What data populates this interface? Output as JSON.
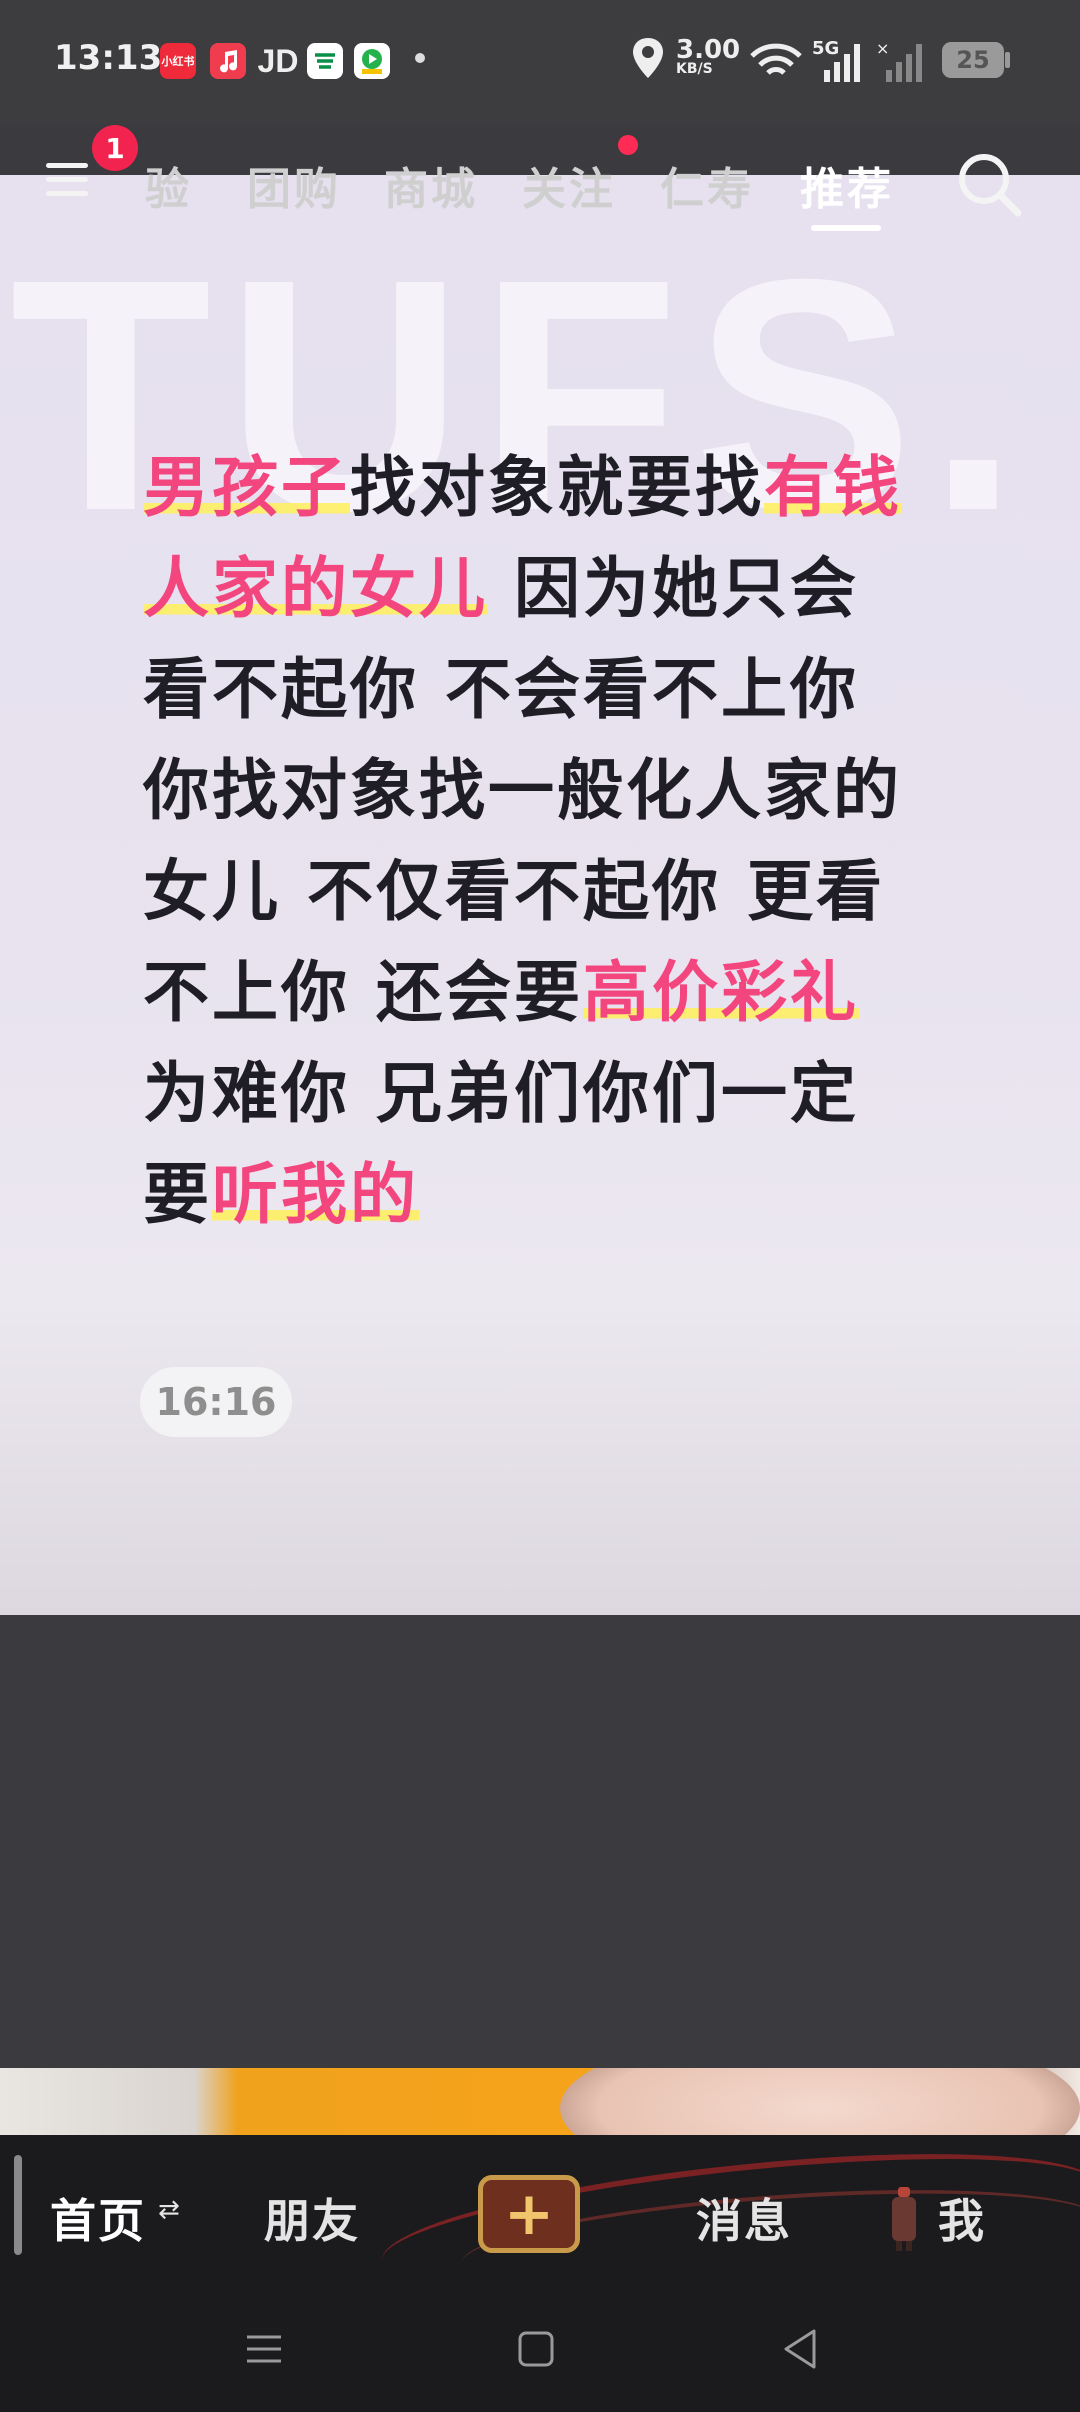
{
  "status_bar": {
    "time": "13:13",
    "apps": [
      "小红书",
      "music",
      "JD",
      "post",
      "video"
    ],
    "jd_label": "JD",
    "xhs_label": "小红书",
    "speed_value": "3.00",
    "speed_unit": "KB/S",
    "network": "5G",
    "battery": "25"
  },
  "top_nav": {
    "menu_badge": "1",
    "tabs": [
      "验",
      "团购",
      "商城",
      "关注",
      "仁寿",
      "推荐"
    ],
    "active_tab": "推荐"
  },
  "post": {
    "watermark": "TUFS.",
    "lines": [
      [
        {
          "t": "男孩子",
          "h": true
        },
        {
          "t": "找对象就要找",
          "h": false
        },
        {
          "t": "有钱",
          "h": true
        }
      ],
      [
        {
          "t": "人家的女儿",
          "h": true
        },
        {
          "t": " 因为她只会",
          "h": false
        }
      ],
      [
        {
          "t": "看不起你 不会看不上你",
          "h": false
        }
      ],
      [
        {
          "t": "你找对象找一般化人家的",
          "h": false
        }
      ],
      [
        {
          "t": "女儿 不仅看不起你 更看",
          "h": false
        }
      ],
      [
        {
          "t": "不上你 还会要",
          "h": false
        },
        {
          "t": "高价彩礼",
          "h": true
        }
      ],
      [
        {
          "t": "为难你 兄弟们你们一定",
          "h": false
        }
      ],
      [
        {
          "t": "要",
          "h": false
        },
        {
          "t": "听我的",
          "h": true
        }
      ]
    ],
    "time_tag": "16:16"
  },
  "bottom_tabs": {
    "home": "首页",
    "home_swap": "⇄",
    "friends": "朋友",
    "plus": "+",
    "messages": "消息",
    "me": "我"
  },
  "colors": {
    "highlight_pink": "#f3467f",
    "highlight_yellow": "#fff05a",
    "badge_red": "#f2244f"
  }
}
